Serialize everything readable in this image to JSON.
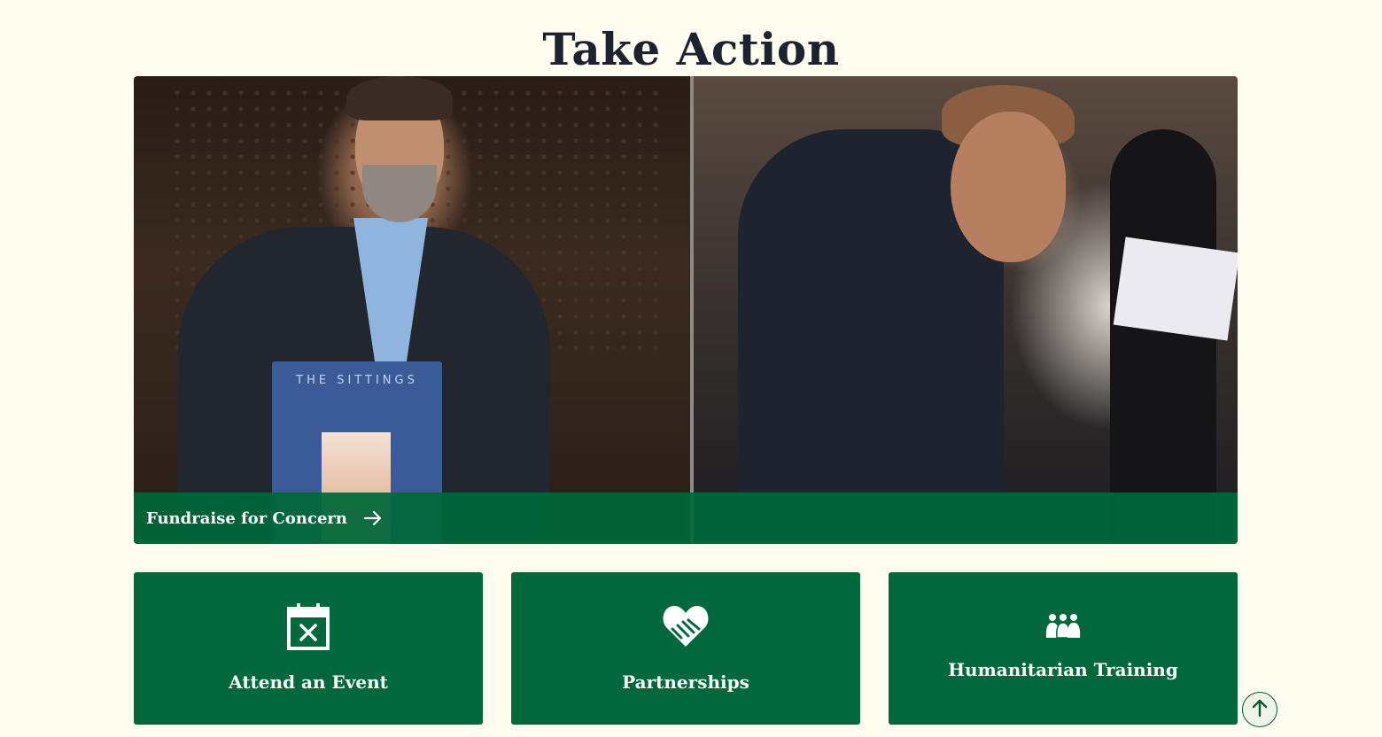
{
  "section": {
    "title": "Take Action"
  },
  "hero": {
    "book_text": "THE SITTINGS",
    "cta_label": "Fundraise for Concern",
    "cta_icon": "arrow-right-icon"
  },
  "cards": [
    {
      "label": "Attend an Event",
      "icon": "calendar-x-icon"
    },
    {
      "label": "Partnerships",
      "icon": "handshake-heart-icon"
    },
    {
      "label": "Humanitarian Training",
      "icon": "people-group-icon"
    }
  ],
  "back_to_top": {
    "icon": "arrow-up-icon"
  },
  "colors": {
    "background": "#fffdf0",
    "brand_green": "#00683a",
    "title_text": "#1c2230"
  }
}
